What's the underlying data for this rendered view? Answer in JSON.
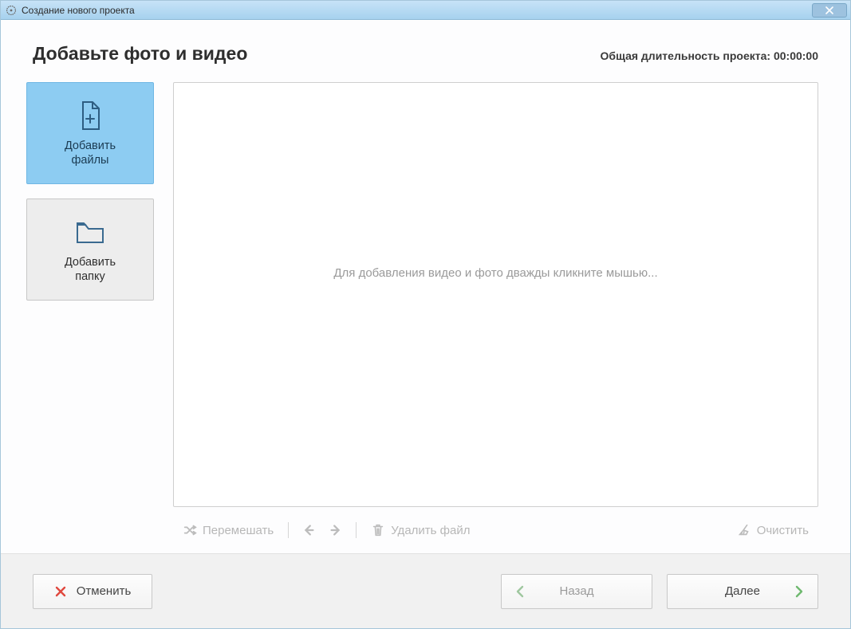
{
  "window": {
    "title": "Создание нового проекта"
  },
  "header": {
    "heading": "Добавьте фото и видео",
    "duration_label": "Общая длительность проекта:",
    "duration_value": "00:00:00"
  },
  "side": {
    "add_files": "Добавить\nфайлы",
    "add_folder": "Добавить\nпапку"
  },
  "canvas": {
    "placeholder": "Для добавления видео и фото дважды кликните мышью..."
  },
  "toolbar": {
    "shuffle": "Перемешать",
    "delete": "Удалить файл",
    "clear": "Очистить"
  },
  "footer": {
    "cancel": "Отменить",
    "back": "Назад",
    "next": "Далее"
  },
  "colors": {
    "accent": "#8dccf2",
    "title_gradient_top": "#c7e3f7",
    "title_gradient_bottom": "#a6d1ee"
  }
}
